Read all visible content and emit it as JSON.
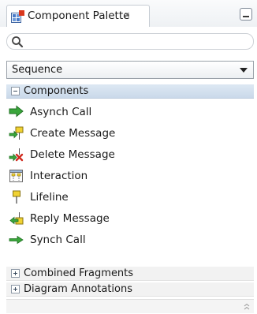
{
  "palette": {
    "title": "Component Palette",
    "close_glyph": "x",
    "search": {
      "value": "",
      "placeholder": ""
    },
    "selector": {
      "selected": "Sequence"
    },
    "sections": [
      {
        "label": "Components",
        "expanded": true,
        "items": [
          {
            "label": "Asynch Call",
            "icon": "async-call-arrow-icon"
          },
          {
            "label": "Create Message",
            "icon": "create-message-icon"
          },
          {
            "label": "Delete Message",
            "icon": "delete-message-icon"
          },
          {
            "label": "Interaction",
            "icon": "interaction-icon"
          },
          {
            "label": "Lifeline",
            "icon": "lifeline-icon"
          },
          {
            "label": "Reply Message",
            "icon": "reply-message-icon"
          },
          {
            "label": "Synch Call",
            "icon": "sync-call-arrow-icon"
          }
        ]
      },
      {
        "label": "Combined Fragments",
        "expanded": false
      },
      {
        "label": "Diagram Annotations",
        "expanded": false
      }
    ]
  },
  "colors": {
    "section_header": "#cad9ea",
    "accent_green": "#39a53a",
    "accent_yellow": "#f0d232",
    "accent_red": "#d02a1e"
  }
}
